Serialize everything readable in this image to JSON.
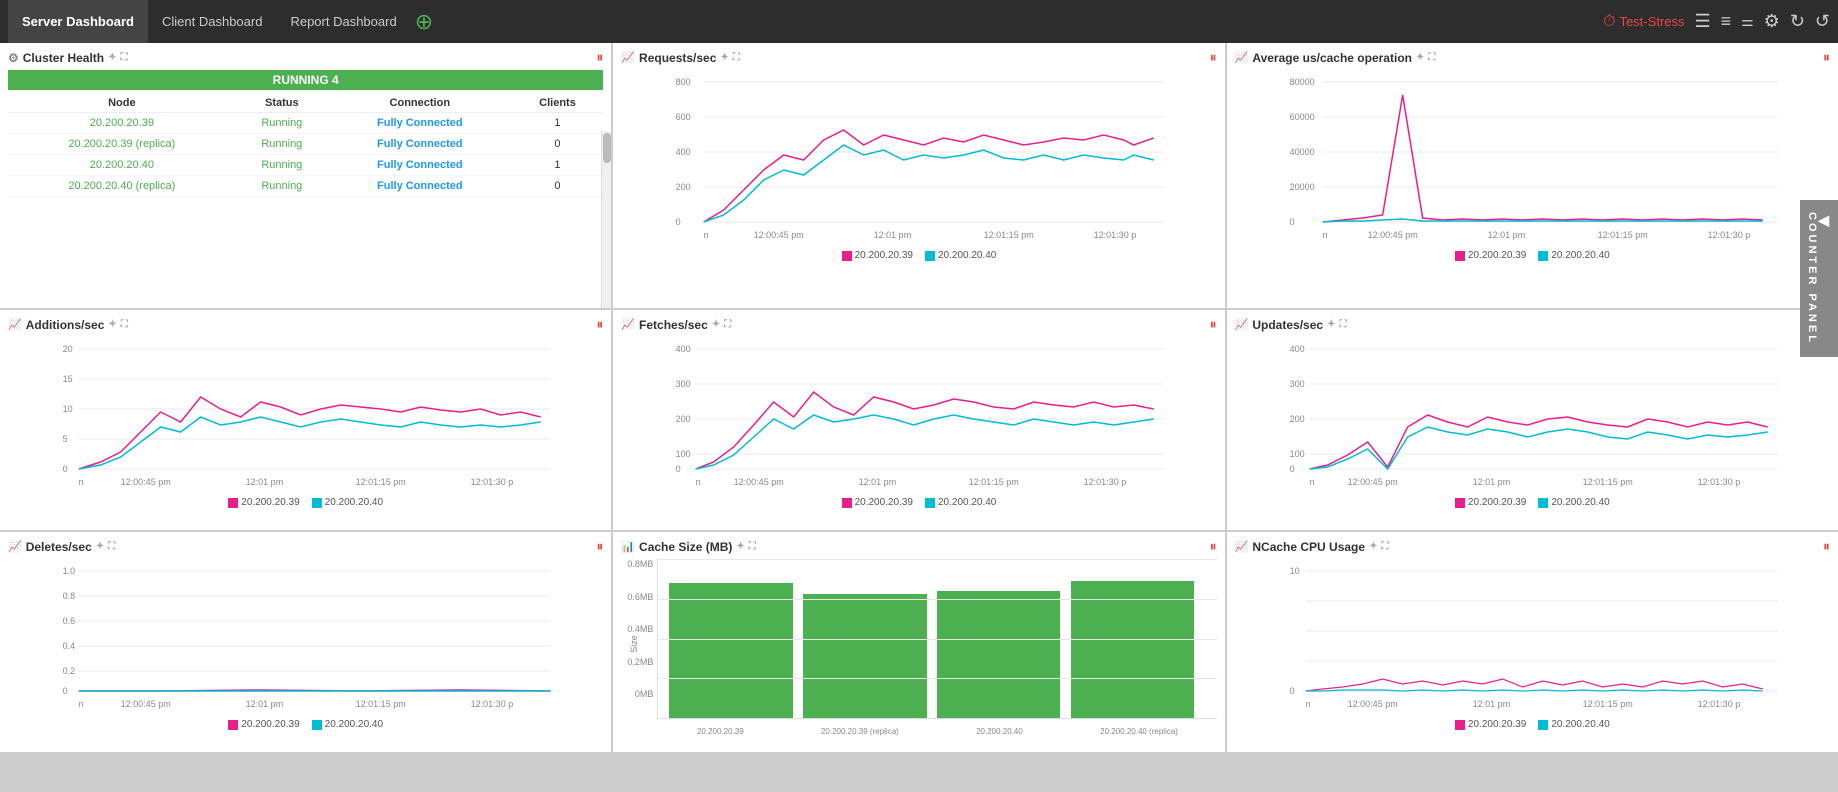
{
  "app": {
    "title": "Server Dashboard",
    "tabs": [
      {
        "label": "Server Dashboard",
        "active": true
      },
      {
        "label": "Client Dashboard",
        "active": false
      },
      {
        "label": "Report Dashboard",
        "active": false
      }
    ],
    "brand": "Test-Stress"
  },
  "cluster": {
    "title": "Cluster Health",
    "running_label": "RUNNING 4",
    "columns": [
      "Node",
      "Status",
      "Connection",
      "Clients"
    ],
    "rows": [
      {
        "node": "20.200.20.39",
        "status": "Running",
        "connection": "Fully Connected",
        "clients": "1"
      },
      {
        "node": "20.200.20.39 (replica)",
        "status": "Running",
        "connection": "Fully Connected",
        "clients": "0"
      },
      {
        "node": "20.200.20.40",
        "status": "Running",
        "connection": "Fully Connected",
        "clients": "1"
      },
      {
        "node": "20.200.20.40 (replica)",
        "status": "Running",
        "connection": "Fully Connected",
        "clients": "0"
      }
    ]
  },
  "panels": {
    "requests": {
      "title": "Requests/sec"
    },
    "avg_cache": {
      "title": "Average us/cache operation"
    },
    "additions": {
      "title": "Additions/sec"
    },
    "fetches": {
      "title": "Fetches/sec"
    },
    "updates": {
      "title": "Updates/sec"
    },
    "deletes": {
      "title": "Deletes/sec"
    },
    "cache_size": {
      "title": "Cache Size (MB)"
    },
    "ncache_cpu": {
      "title": "NCache CPU Usage"
    }
  },
  "legend": {
    "node1": "20.200.20.39",
    "node2": "20.200.20.40"
  },
  "counter_panel": "COUNTER PANEL",
  "time_labels": [
    "n",
    "12:00:45 pm",
    "12:01 pm",
    "12:01:15 pm",
    "12:01:30 p"
  ],
  "colors": {
    "pink": "#e91e8c",
    "cyan": "#00bcd4",
    "green": "#4caf50",
    "accent": "#e44"
  }
}
